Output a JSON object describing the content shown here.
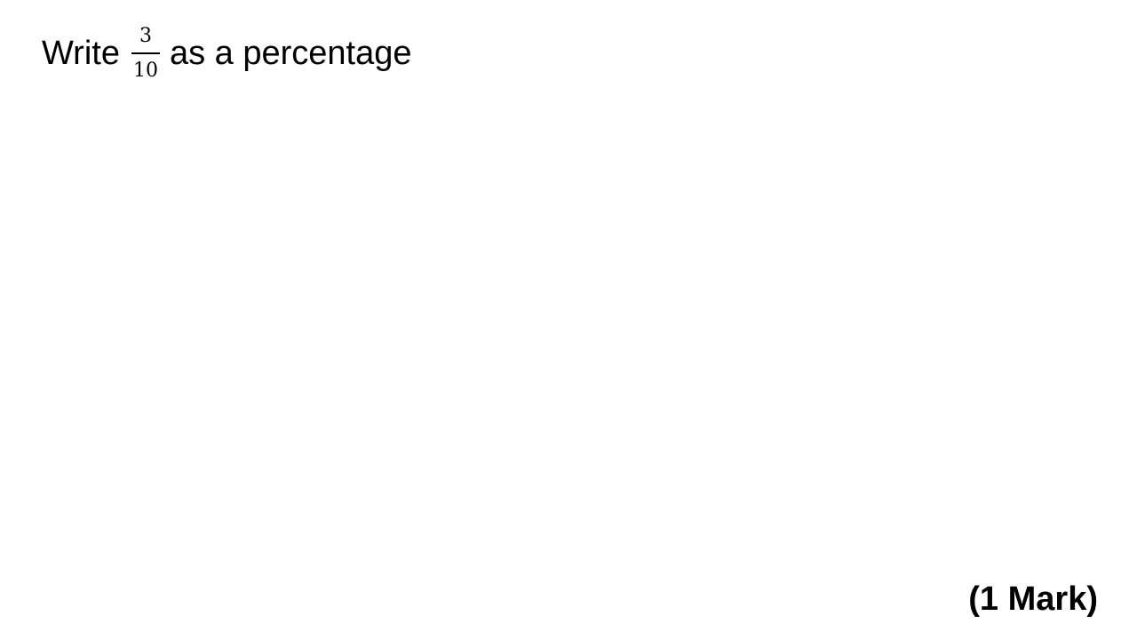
{
  "question": {
    "prefix": "Write",
    "fraction": {
      "numerator": "3",
      "denominator": "10"
    },
    "suffix": "as a percentage"
  },
  "marks_label": "(1 Mark)"
}
